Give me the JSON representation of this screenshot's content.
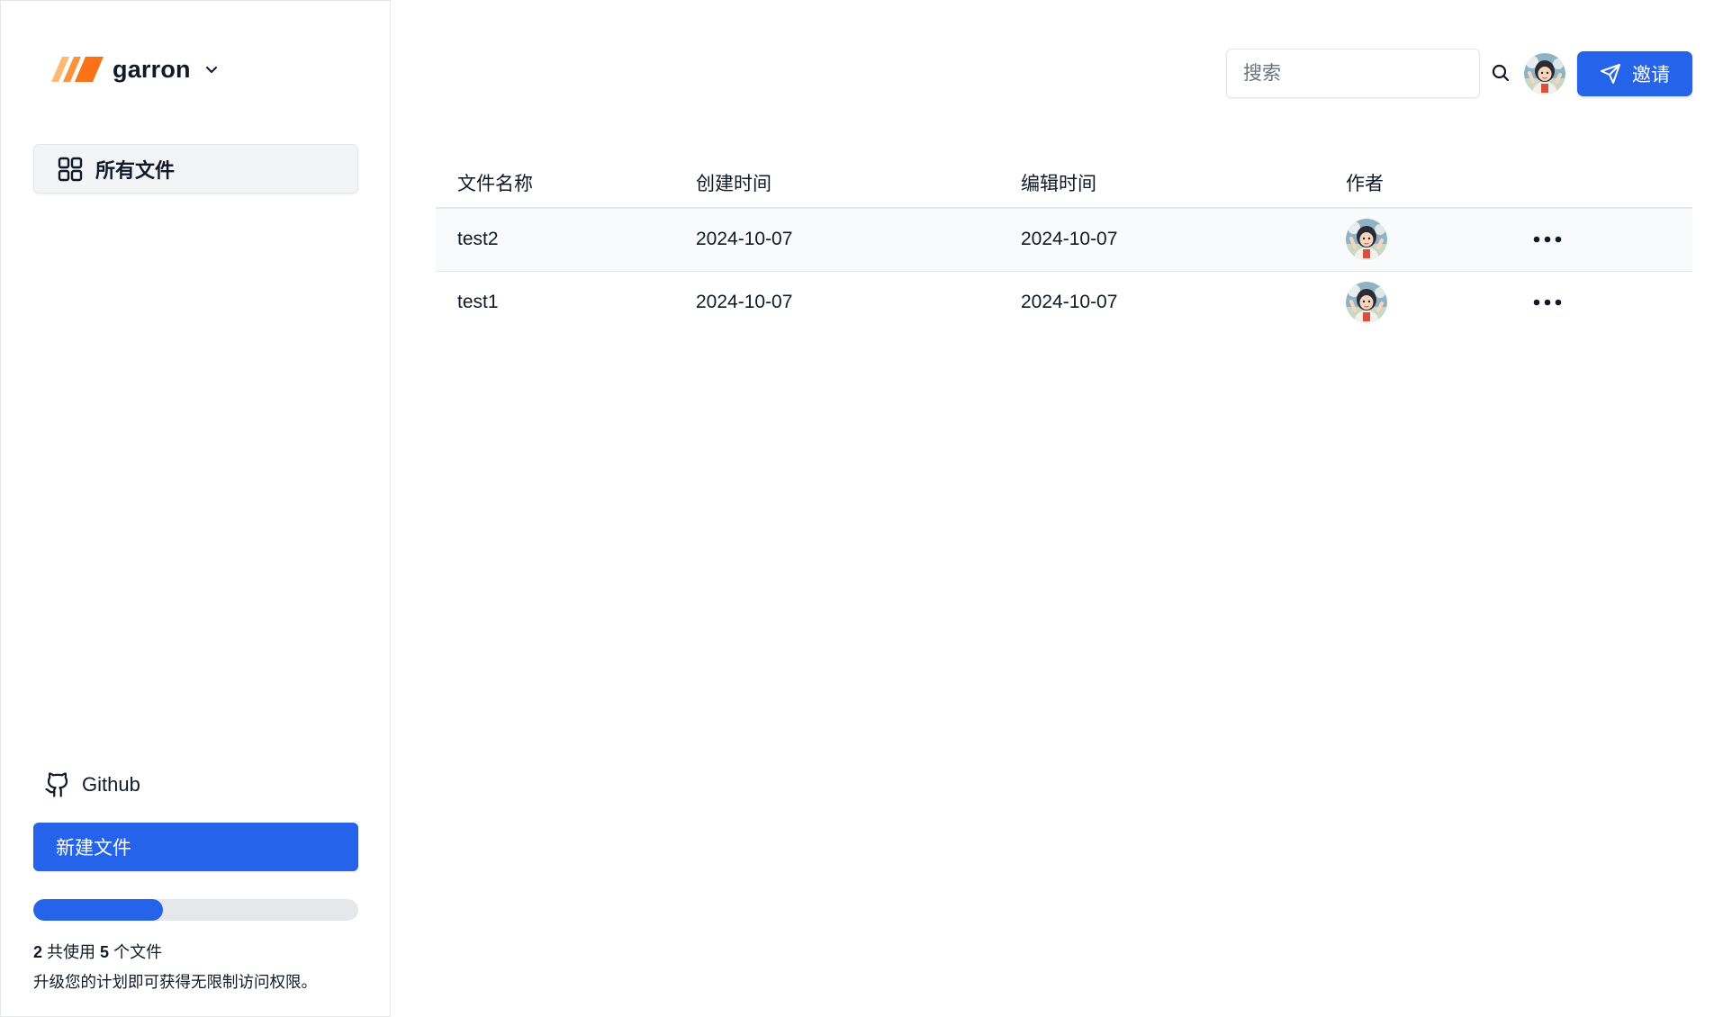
{
  "sidebar": {
    "brand": {
      "name": "garron",
      "logo_colors": [
        "#fdba74",
        "#fb923c",
        "#f97316"
      ]
    },
    "nav": [
      {
        "label": "所有文件",
        "icon": "grid-icon",
        "active": true
      }
    ],
    "github": {
      "label": "Github",
      "icon": "github-icon"
    },
    "new_file_label": "新建文件",
    "usage": {
      "used": "2",
      "middle": "共使用",
      "total": "5",
      "suffix": "个文件",
      "fraction": 0.4
    },
    "upgrade_text": "升级您的计划即可获得无限制访问权限。"
  },
  "header": {
    "search": {
      "placeholder": "搜索",
      "value": ""
    },
    "invite_label": "邀请"
  },
  "table": {
    "columns": [
      "文件名称",
      "创建时间",
      "编辑时间",
      "作者"
    ],
    "rows": [
      {
        "name": "test2",
        "created": "2024-10-07",
        "edited": "2024-10-07"
      },
      {
        "name": "test1",
        "created": "2024-10-07",
        "edited": "2024-10-07"
      }
    ]
  },
  "colors": {
    "accent": "#2563eb",
    "border": "#e5e7eb",
    "muted_bg": "#f3f4f6"
  }
}
